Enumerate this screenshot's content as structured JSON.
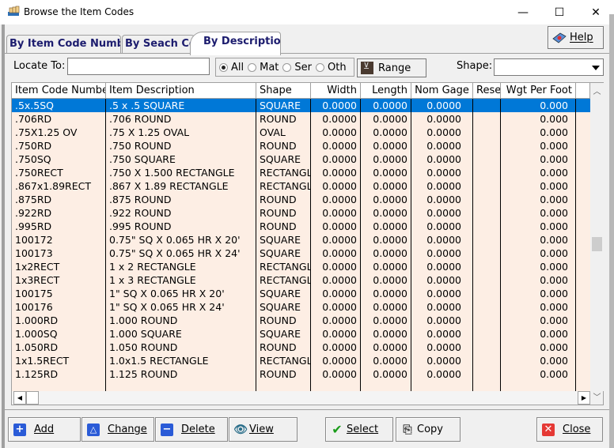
{
  "window": {
    "title": "Browse the Item Codes",
    "controls": {
      "minimize": "—",
      "maximize": "☐",
      "close": "✕"
    }
  },
  "tabs": [
    {
      "label": "By Item Code Number",
      "active": false
    },
    {
      "label": "By Seach Code",
      "active": false
    },
    {
      "label": "By Description",
      "active": true
    }
  ],
  "help_button": {
    "label": "Help",
    "icon": "help-book-icon"
  },
  "filters": {
    "locate_label": "Locate To:",
    "locate_value": "",
    "radios": [
      {
        "label": "All",
        "checked": true
      },
      {
        "label": "Mat",
        "checked": false
      },
      {
        "label": "Ser",
        "checked": false
      },
      {
        "label": "Oth",
        "checked": false
      }
    ],
    "range_label": "Range",
    "shape_label": "Shape:",
    "shape_value": ""
  },
  "grid": {
    "columns": [
      "Item Code Number",
      "Item Description",
      "Shape",
      "Width",
      "Length",
      "Nom Gage",
      "Reserved",
      "Wgt Per Foot"
    ],
    "selected_row": 0,
    "rows": [
      [
        ".5x.5SQ",
        ".5 x .5 SQUARE",
        "SQUARE",
        "0.0000",
        "0.0000",
        "0.0000",
        "",
        "0.000"
      ],
      [
        ".706RD",
        ".706 ROUND",
        "ROUND",
        "0.0000",
        "0.0000",
        "0.0000",
        "",
        "0.000"
      ],
      [
        ".75X1.25 OV",
        ".75 X 1.25 OVAL",
        "OVAL",
        "0.0000",
        "0.0000",
        "0.0000",
        "",
        "0.000"
      ],
      [
        ".750RD",
        ".750 ROUND",
        "ROUND",
        "0.0000",
        "0.0000",
        "0.0000",
        "",
        "0.000"
      ],
      [
        ".750SQ",
        ".750 SQUARE",
        "SQUARE",
        "0.0000",
        "0.0000",
        "0.0000",
        "",
        "0.000"
      ],
      [
        ".750RECT",
        ".750 X 1.500 RECTANGLE",
        "RECTANGLE",
        "0.0000",
        "0.0000",
        "0.0000",
        "",
        "0.000"
      ],
      [
        ".867x1.89RECT",
        ".867 X 1.89 RECTANGLE",
        "RECTANGLE",
        "0.0000",
        "0.0000",
        "0.0000",
        "",
        "0.000"
      ],
      [
        ".875RD",
        ".875 ROUND",
        "ROUND",
        "0.0000",
        "0.0000",
        "0.0000",
        "",
        "0.000"
      ],
      [
        ".922RD",
        ".922 ROUND",
        "ROUND",
        "0.0000",
        "0.0000",
        "0.0000",
        "",
        "0.000"
      ],
      [
        ".995RD",
        ".995 ROUND",
        "ROUND",
        "0.0000",
        "0.0000",
        "0.0000",
        "",
        "0.000"
      ],
      [
        "100172",
        "0.75\" SQ X 0.065 HR X 20'",
        "SQUARE",
        "0.0000",
        "0.0000",
        "0.0000",
        "",
        "0.000"
      ],
      [
        "100173",
        "0.75\" SQ X 0.065 HR X 24'",
        "SQUARE",
        "0.0000",
        "0.0000",
        "0.0000",
        "",
        "0.000"
      ],
      [
        "1x2RECT",
        "1 x 2 RECTANGLE",
        "RECTANGLE",
        "0.0000",
        "0.0000",
        "0.0000",
        "",
        "0.000"
      ],
      [
        "1x3RECT",
        "1 x 3 RECTANGLE",
        "RECTANGLE",
        "0.0000",
        "0.0000",
        "0.0000",
        "",
        "0.000"
      ],
      [
        "100175",
        "1\" SQ X 0.065 HR X 20'",
        "SQUARE",
        "0.0000",
        "0.0000",
        "0.0000",
        "",
        "0.000"
      ],
      [
        "100176",
        "1\" SQ X 0.065 HR X 24'",
        "SQUARE",
        "0.0000",
        "0.0000",
        "0.0000",
        "",
        "0.000"
      ],
      [
        "1.000RD",
        "1.000 ROUND",
        "ROUND",
        "0.0000",
        "0.0000",
        "0.0000",
        "",
        "0.000"
      ],
      [
        "1.000SQ",
        "1.000 SQUARE",
        "SQUARE",
        "0.0000",
        "0.0000",
        "0.0000",
        "",
        "0.000"
      ],
      [
        "1.050RD",
        "1.050 ROUND",
        "ROUND",
        "0.0000",
        "0.0000",
        "0.0000",
        "",
        "0.000"
      ],
      [
        "1x1.5RECT",
        "1.0x1.5 RECTANGLE",
        "RECTANGLE",
        "0.0000",
        "0.0000",
        "0.0000",
        "",
        "0.000"
      ],
      [
        "1.125RD",
        "1.125 ROUND",
        "ROUND",
        "0.0000",
        "0.0000",
        "0.0000",
        "",
        "0.000"
      ]
    ]
  },
  "buttons": {
    "add": "Add",
    "change": "Change",
    "delete": "Delete",
    "view": "View",
    "select": "Select",
    "copy": "Copy",
    "close": "Close"
  },
  "colors": {
    "row_bg": "#fdeee4",
    "selected_bg": "#0078d7",
    "tab_text": "#1c1c6e",
    "button_icon_blue": "#2a5bd7",
    "close_icon_red": "#e53935",
    "select_check_green": "#1a9c1a"
  }
}
